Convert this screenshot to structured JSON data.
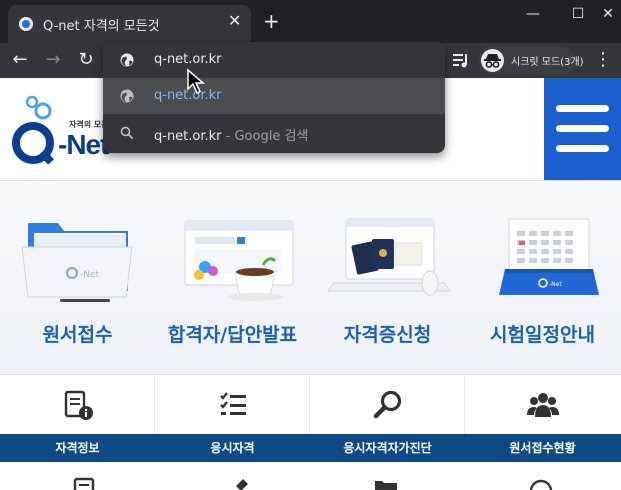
{
  "browser": {
    "tab": {
      "title": "Q-net 자격의 모든것",
      "close": "✕"
    },
    "new_tab": "+",
    "window": {
      "minimize": "—",
      "maximize": "☐",
      "close": "✕"
    },
    "nav": {
      "back": "←",
      "forward": "→",
      "reload": "↻"
    },
    "incognito_label": "시크릿 모드(3개)",
    "more": "⋮"
  },
  "omnibox": {
    "suggestions": [
      {
        "icon": "globe-icon",
        "text": "q-net.or.kr",
        "sub": ""
      },
      {
        "icon": "globe-icon",
        "text": "q-net.or.kr",
        "sub": ""
      },
      {
        "icon": "search-icon",
        "text": "q-net.or.kr",
        "sub": " - Google 검색"
      }
    ]
  },
  "page": {
    "logo_tagline": "자격의 모든",
    "logo_word": "Net",
    "services": [
      {
        "label": "원서접수"
      },
      {
        "label": "합격자/답안발표"
      },
      {
        "label": "자격증신청"
      },
      {
        "label": "시험일정안내"
      }
    ],
    "submenu": [
      {
        "label": "자격정보"
      },
      {
        "label": "응시자격"
      },
      {
        "label": "응시자격자가진단"
      },
      {
        "label": "원서접수현황"
      }
    ]
  },
  "colors": {
    "chrome_dark": "#202124",
    "accent_blue": "#1b5fcf",
    "label_blue": "#1b5fb5",
    "submenu_bar": "#0e4a86"
  }
}
